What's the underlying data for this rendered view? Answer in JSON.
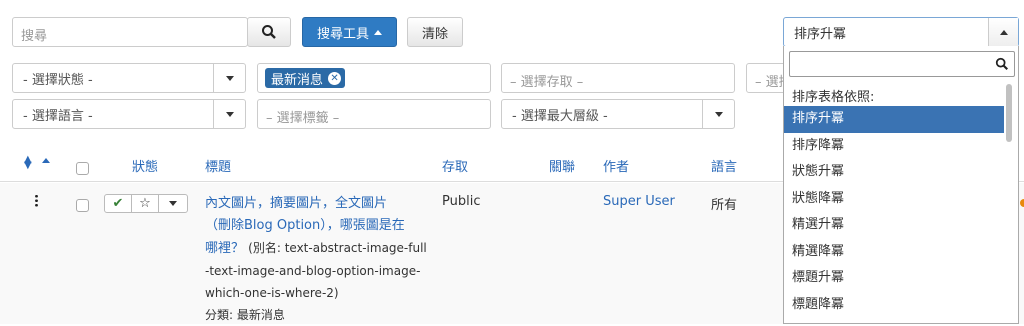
{
  "search": {
    "placeholder": "搜尋",
    "tools_label": "搜尋工具",
    "clear_label": "清除"
  },
  "filters": {
    "status": "- 選擇狀態 -",
    "tag_chip": "最新消息",
    "access": "– 選擇存取 –",
    "access2_partial": "– 選擇",
    "language": "- 選擇語言 -",
    "tags": "– 選擇標籤 –",
    "max_level": "- 選擇最大層級 -"
  },
  "table": {
    "headers": {
      "status": "狀態",
      "title": "標題",
      "access": "存取",
      "assoc": "關聯",
      "author": "作者",
      "language": "語言"
    },
    "rows": [
      {
        "title_link": "內文圖片，摘要圖片，全文圖片（刪除Blog Option），哪張圖是在哪裡？",
        "title_line1": "內文圖片，摘要圖片，全文圖片",
        "title_line2": "（刪除Blog Option），哪張圖是在",
        "title_line3": "哪裡？",
        "alias_line1": "(別名: text-abstract-image-full",
        "alias_line2": "-text-image-and-blog-option-image-",
        "alias_line3": "which-one-is-where-2)",
        "category": "分類: 最新消息",
        "access": "Public",
        "author": "Super User",
        "language": "所有"
      }
    ]
  },
  "sort": {
    "selected": "排序升冪",
    "group_label": "排序表格依照:",
    "options": [
      "排序升冪",
      "排序降冪",
      "狀態升冪",
      "狀態降冪",
      "精選升冪",
      "精選降冪",
      "標題升冪",
      "標題降冪"
    ]
  },
  "colors": {
    "primary": "#2f7bc3",
    "link": "#2a69b8",
    "selected": "#3a73b3",
    "success": "#378137"
  }
}
